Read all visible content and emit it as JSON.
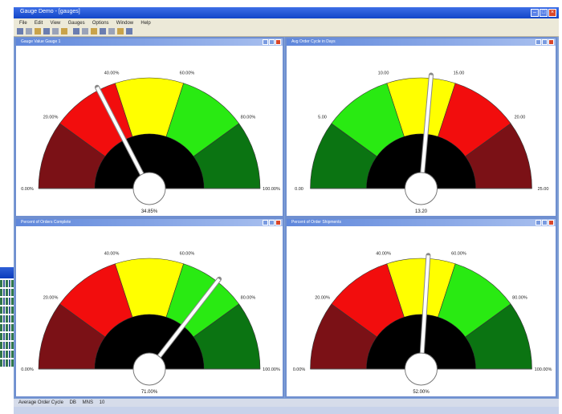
{
  "app": {
    "title": "Gauge Demo - [gauges]",
    "menu": [
      "File",
      "Edit",
      "View",
      "Gauges",
      "Options",
      "Window",
      "Help"
    ],
    "toolbar_icons": [
      "new-icon",
      "open-icon",
      "save-icon",
      "cut-icon",
      "copy-icon",
      "paste-icon",
      "print-icon",
      "undo-icon",
      "redo-icon",
      "zoom-in-icon",
      "zoom-out-icon",
      "window-tile-icon",
      "help-icon"
    ]
  },
  "status": {
    "left": "Average Order Cycle",
    "mid": "DB",
    "right": "MNS",
    "extra": "10"
  },
  "colors": {
    "darkred": "#7b1116",
    "red": "#f20d0d",
    "yellow": "#ffff00",
    "lightgreen": "#29ea12",
    "darkgreen": "#0b7412",
    "hub": "#000000",
    "title_blue": "#1246c9"
  },
  "gauges": [
    {
      "title": "Gauge Value Gauge 1",
      "segments": [
        "darkred",
        "red",
        "yellow",
        "lightgreen",
        "darkgreen"
      ],
      "ticks": [
        "0.00%",
        "20.00%",
        "40.00%",
        "60.00%",
        "80.00%",
        "100.00%"
      ],
      "value": 34.85,
      "value_label": "34.85%"
    },
    {
      "title": "Avg Order Cycle in Days",
      "segments": [
        "darkgreen",
        "lightgreen",
        "yellow",
        "red",
        "darkred"
      ],
      "ticks": [
        "0.00",
        "5.00",
        "10.00",
        "15.00",
        "20.00",
        "25.00"
      ],
      "value": 13.2,
      "range": [
        0,
        25
      ],
      "value_label": "13.20"
    },
    {
      "title": "Percent of Orders Complete",
      "segments": [
        "darkred",
        "red",
        "yellow",
        "lightgreen",
        "darkgreen"
      ],
      "ticks": [
        "0.00%",
        "20.00%",
        "40.00%",
        "60.00%",
        "80.00%",
        "100.00%"
      ],
      "value": 71.0,
      "value_label": "71.00%"
    },
    {
      "title": "Percent of Order Shipments",
      "segments": [
        "darkred",
        "red",
        "yellow",
        "lightgreen",
        "darkgreen"
      ],
      "ticks": [
        "0.00%",
        "20.00%",
        "40.00%",
        "60.00%",
        "80.00%",
        "100.00%"
      ],
      "value": 52.0,
      "value_label": "52.00%"
    }
  ]
}
